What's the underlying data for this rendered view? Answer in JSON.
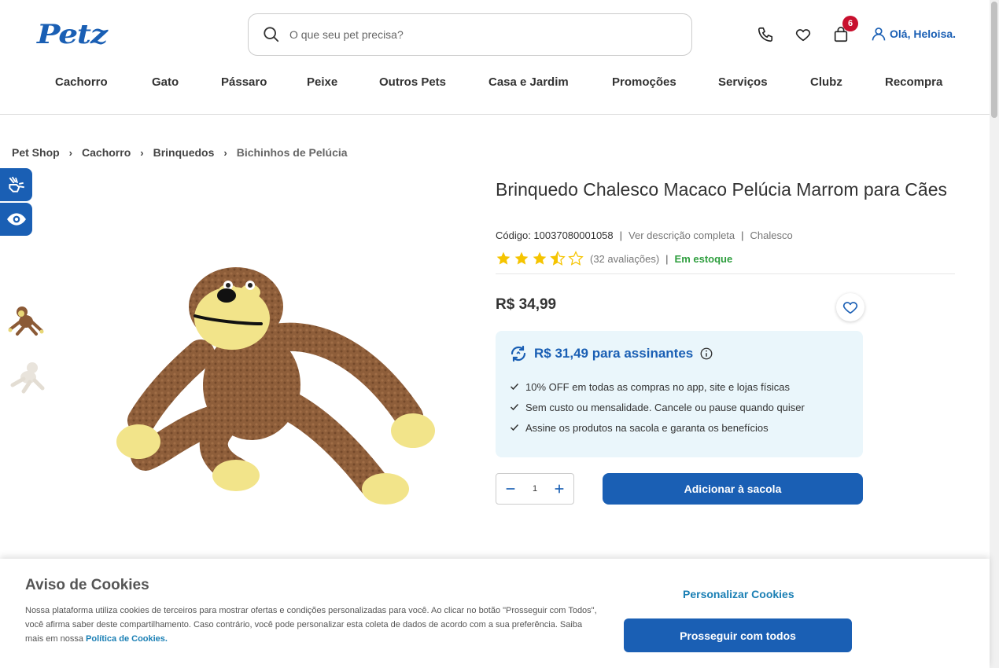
{
  "header": {
    "logo_text": "Petz",
    "search_placeholder": "O que seu pet precisa?",
    "cart_count": "6",
    "user_greeting": "Olá, Heloisa.",
    "brand_color": "#1a5fb4"
  },
  "nav": {
    "items": [
      "Cachorro",
      "Gato",
      "Pássaro",
      "Peixe",
      "Outros Pets",
      "Casa e Jardim",
      "Promoções",
      "Serviços",
      "Clubz",
      "Recompra"
    ]
  },
  "breadcrumb": {
    "items": [
      "Pet Shop",
      "Cachorro",
      "Brinquedos",
      "Bichinhos de Pelúcia"
    ]
  },
  "product": {
    "title": "Brinquedo Chalesco Macaco Pelúcia Marrom para Cães",
    "code_label": "Código: 10037080001058",
    "description_link": "Ver descrição completa",
    "brand": "Chalesco",
    "rating": 3.5,
    "reviews": "(32 avaliações)",
    "stock": "Em estoque",
    "price": "R$ 34,99",
    "subscriber_price": "R$ 31,49 para assinantes",
    "benefits": [
      "10% OFF em todas as compras no app, site e lojas físicas",
      "Sem custo ou mensalidade. Cancele ou pause quando quiser",
      "Assine os produtos na sacola e garanta os benefícios"
    ],
    "quantity": "1",
    "add_to_cart": "Adicionar à sacola"
  },
  "cookies": {
    "title": "Aviso de Cookies",
    "text": "Nossa plataforma utiliza cookies de terceiros para mostrar ofertas e condições personalizadas para você. Ao clicar no botão \"Prosseguir com Todos\", você afirma saber deste compartilhamento. Caso contrário, você pode personalizar esta coleta de dados de acordo com a sua preferência. Saiba mais em nossa",
    "policy_link": "Política de Cookies.",
    "personalize": "Personalizar Cookies",
    "accept": "Prosseguir com todos"
  }
}
